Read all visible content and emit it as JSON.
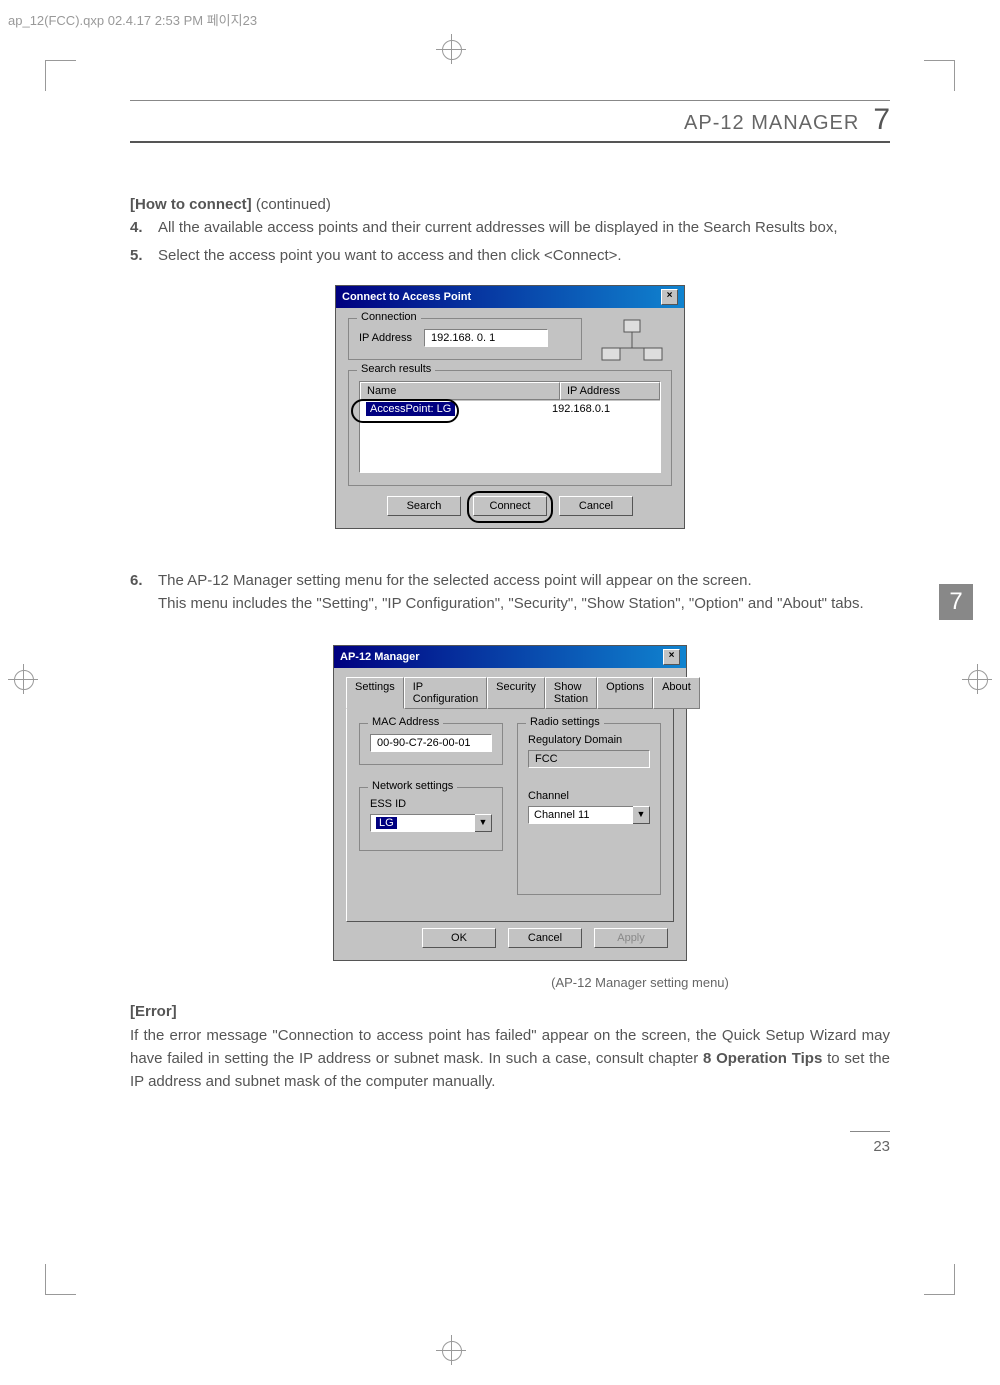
{
  "file_header": "ap_12(FCC).qxp  02.4.17  2:53 PM  페이지23",
  "section_title": "AP-12 MANAGER",
  "section_number": "7",
  "side_tab": "7",
  "page_number": "23",
  "heading_continued": "[How to connect]",
  "heading_continued_suffix": " (continued)",
  "step4_num": "4.",
  "step4_text": "All the available access points and their current addresses will be displayed in the Search Results box,",
  "step5_num": "5.",
  "step5_text": "Select the access point you want to access and then click <Connect>.",
  "step6_num": "6.",
  "step6_text_a": "The AP-12 Manager setting menu for the selected access point will appear on the screen.",
  "step6_text_b": "This menu includes the \"Setting\", \"IP Configuration\", \"Security\", \"Show Station\", \"Option\" and \"About\" tabs.",
  "caption_manager": "(AP-12 Manager setting menu)",
  "error_heading": "[Error]",
  "error_para_a": "If the error message \"Connection to access point has failed\" appear on the screen, the Quick Setup Wizard may have failed in setting the IP address or subnet mask. In such a case, consult chapter ",
  "error_para_bold": "8 Operation Tips",
  "error_para_b": " to set the IP address and subnet mask of the computer manually.",
  "dialog1": {
    "title": "Connect to Access Point",
    "conn_legend": "Connection",
    "ip_label": "IP Address",
    "ip_value": "192.168.    0.    1",
    "search_legend": "Search results",
    "col_name": "Name",
    "col_ip": "IP Address",
    "row_name": "AccessPoint: LG",
    "row_ip": "192.168.0.1",
    "btn_search": "Search",
    "btn_connect": "Connect",
    "btn_cancel": "Cancel"
  },
  "dialog2": {
    "title": "AP-12 Manager",
    "tabs": {
      "settings": "Settings",
      "ipconf": "IP Configuration",
      "security": "Security",
      "show": "Show Station",
      "options": "Options",
      "about": "About"
    },
    "mac_legend": "MAC Address",
    "mac_value": "00-90-C7-26-00-01",
    "net_legend": "Network settings",
    "ess_label": "ESS ID",
    "ess_value": "LG",
    "radio_legend": "Radio settings",
    "reg_label": "Regulatory Domain",
    "reg_value": "FCC",
    "chan_label": "Channel",
    "chan_value": "Channel 11",
    "btn_ok": "OK",
    "btn_cancel": "Cancel",
    "btn_apply": "Apply"
  }
}
